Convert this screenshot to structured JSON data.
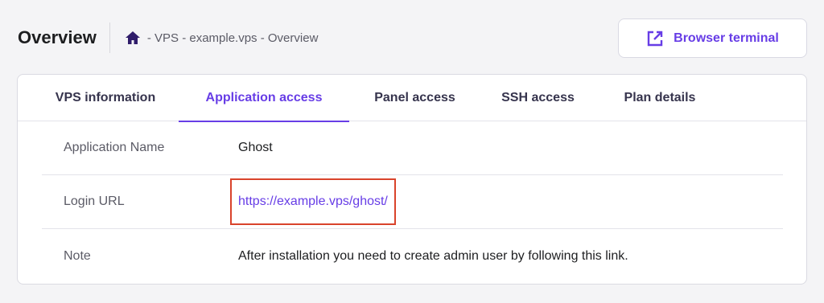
{
  "header": {
    "title": "Overview",
    "breadcrumb": {
      "home_icon": "home-icon",
      "text": "- VPS - example.vps - Overview"
    },
    "terminal_button": {
      "icon": "external-link-icon",
      "label": "Browser terminal"
    }
  },
  "tabs": [
    {
      "label": "VPS information",
      "active": false
    },
    {
      "label": "Application access",
      "active": true
    },
    {
      "label": "Panel access",
      "active": false
    },
    {
      "label": "SSH access",
      "active": false
    },
    {
      "label": "Plan details",
      "active": false
    }
  ],
  "details": [
    {
      "label": "Application Name",
      "value": "Ghost"
    },
    {
      "label": "Login URL",
      "value": "https://example.vps/ghost/",
      "highlighted": true
    },
    {
      "label": "Note",
      "value": "After installation you need to create admin user by following this link."
    }
  ],
  "colors": {
    "accent": "#673de6",
    "highlight_border": "#d9432b",
    "background": "#f4f4f6"
  }
}
